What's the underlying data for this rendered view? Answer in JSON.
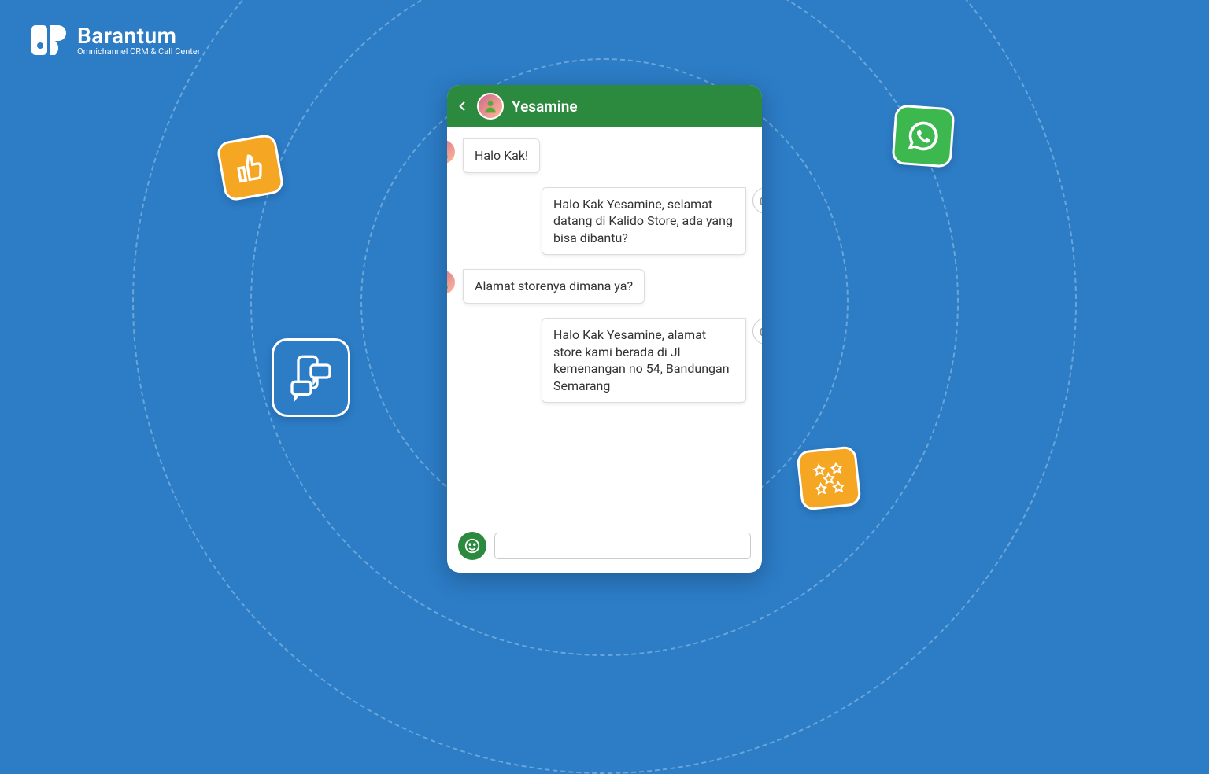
{
  "brand": {
    "title": "Barantum",
    "subtitle": "Omnichannel CRM & Call Center"
  },
  "chat": {
    "contact_name": "Yesamine",
    "messages": [
      {
        "side": "left",
        "sender": "user",
        "text": "Halo Kak!"
      },
      {
        "side": "right",
        "sender": "bot",
        "text": "Halo Kak Yesamine, selamat datang di Kalido Store, ada yang bisa dibantu?"
      },
      {
        "side": "left",
        "sender": "user",
        "text": "Alamat storenya dimana ya?"
      },
      {
        "side": "right",
        "sender": "bot",
        "text": "Halo Kak Yesamine, alamat store kami berada di Jl kemenangan no 54, Bandungan Semarang"
      }
    ],
    "input_placeholder": ""
  },
  "badges": {
    "thumb": "thumbs-up-icon",
    "chat": "phone-chat-icon",
    "whatsapp": "whatsapp-icon",
    "stars": "stars-icon"
  },
  "colors": {
    "bg": "#2C7CC6",
    "header": "#2C8A3E",
    "accent_orange": "#F5A623",
    "accent_green": "#3CB84E"
  }
}
